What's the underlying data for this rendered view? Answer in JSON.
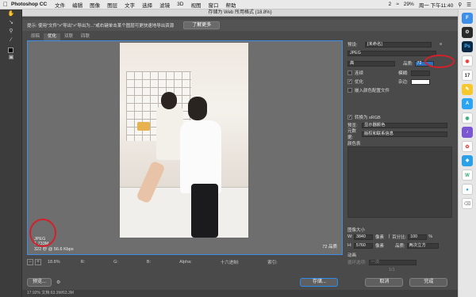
{
  "menubar": {
    "apple": "",
    "app": "Photoshop CC",
    "items": [
      "文件",
      "编辑",
      "图像",
      "图层",
      "文字",
      "选择",
      "滤镜",
      "3D",
      "视图",
      "窗口",
      "帮助"
    ],
    "right": [
      "2",
      "29%",
      "周一 下午11:40"
    ]
  },
  "dialog": {
    "title": "存储为 Web 所用格式 (18.8%)",
    "tip": "提示: 使用\"文件\">\"导出\">\"导出为...\"或右键单击某个图层可更快速地导出资源",
    "learn_more": "了解更多",
    "tabs": [
      "原稿",
      "优化",
      "双联",
      "四联"
    ],
    "active_tab": "优化"
  },
  "preview": {
    "format": "JPEG",
    "size": "1.733M",
    "time": "322 秒 @ 56.6 Kbps",
    "quality_note": "72 品质"
  },
  "zoom": {
    "value": "18.8%",
    "r": "R:",
    "g": "G:",
    "b": "B:",
    "alpha": "Alpha:",
    "hex": "十六进制:",
    "index": "索引:"
  },
  "buttons": {
    "preview": "预览...",
    "save": "存储...",
    "cancel": "取消",
    "done": "完成"
  },
  "status": "17.92%      文档:63.3M/63.3M",
  "settings": {
    "preset_label": "预设:",
    "preset_value": "[未命名]",
    "format_value": "JPEG",
    "quality_level": "高",
    "quality_label": "品质:",
    "quality_value": "72",
    "progressive_label": "连续",
    "blur_label": "模糊:",
    "optimized_label": "优化",
    "matte_label": "杂边:",
    "embed_profile_label": "嵌入颜色配置文件",
    "convert_srgb_label": "转换为 sRGB",
    "preview_label": "预览:",
    "preview_value": "显示器颜色",
    "metadata_label": "元数据:",
    "metadata_value": "版权和联系信息",
    "color_table_label": "颜色表",
    "image_size_label": "图像大小",
    "w_label": "W:",
    "w_value": "3840",
    "h_label": "H:",
    "h_value": "5760",
    "px": "像素",
    "percent_label": "百分比:",
    "percent_value": "100",
    "percent_unit": "%",
    "quality2_label": "品质:",
    "quality2_value": "两次立方",
    "animation_label": "动画",
    "loop_label": "循环选项:",
    "loop_value": "一次",
    "frame_counter": "1/1"
  },
  "dock": {
    "items": [
      "finder",
      "ps",
      "chrome",
      "mail",
      "calendar",
      "photos",
      "appstore"
    ]
  },
  "colors": {
    "accent": "#2d8cf0",
    "highlight": "#d4202a"
  }
}
